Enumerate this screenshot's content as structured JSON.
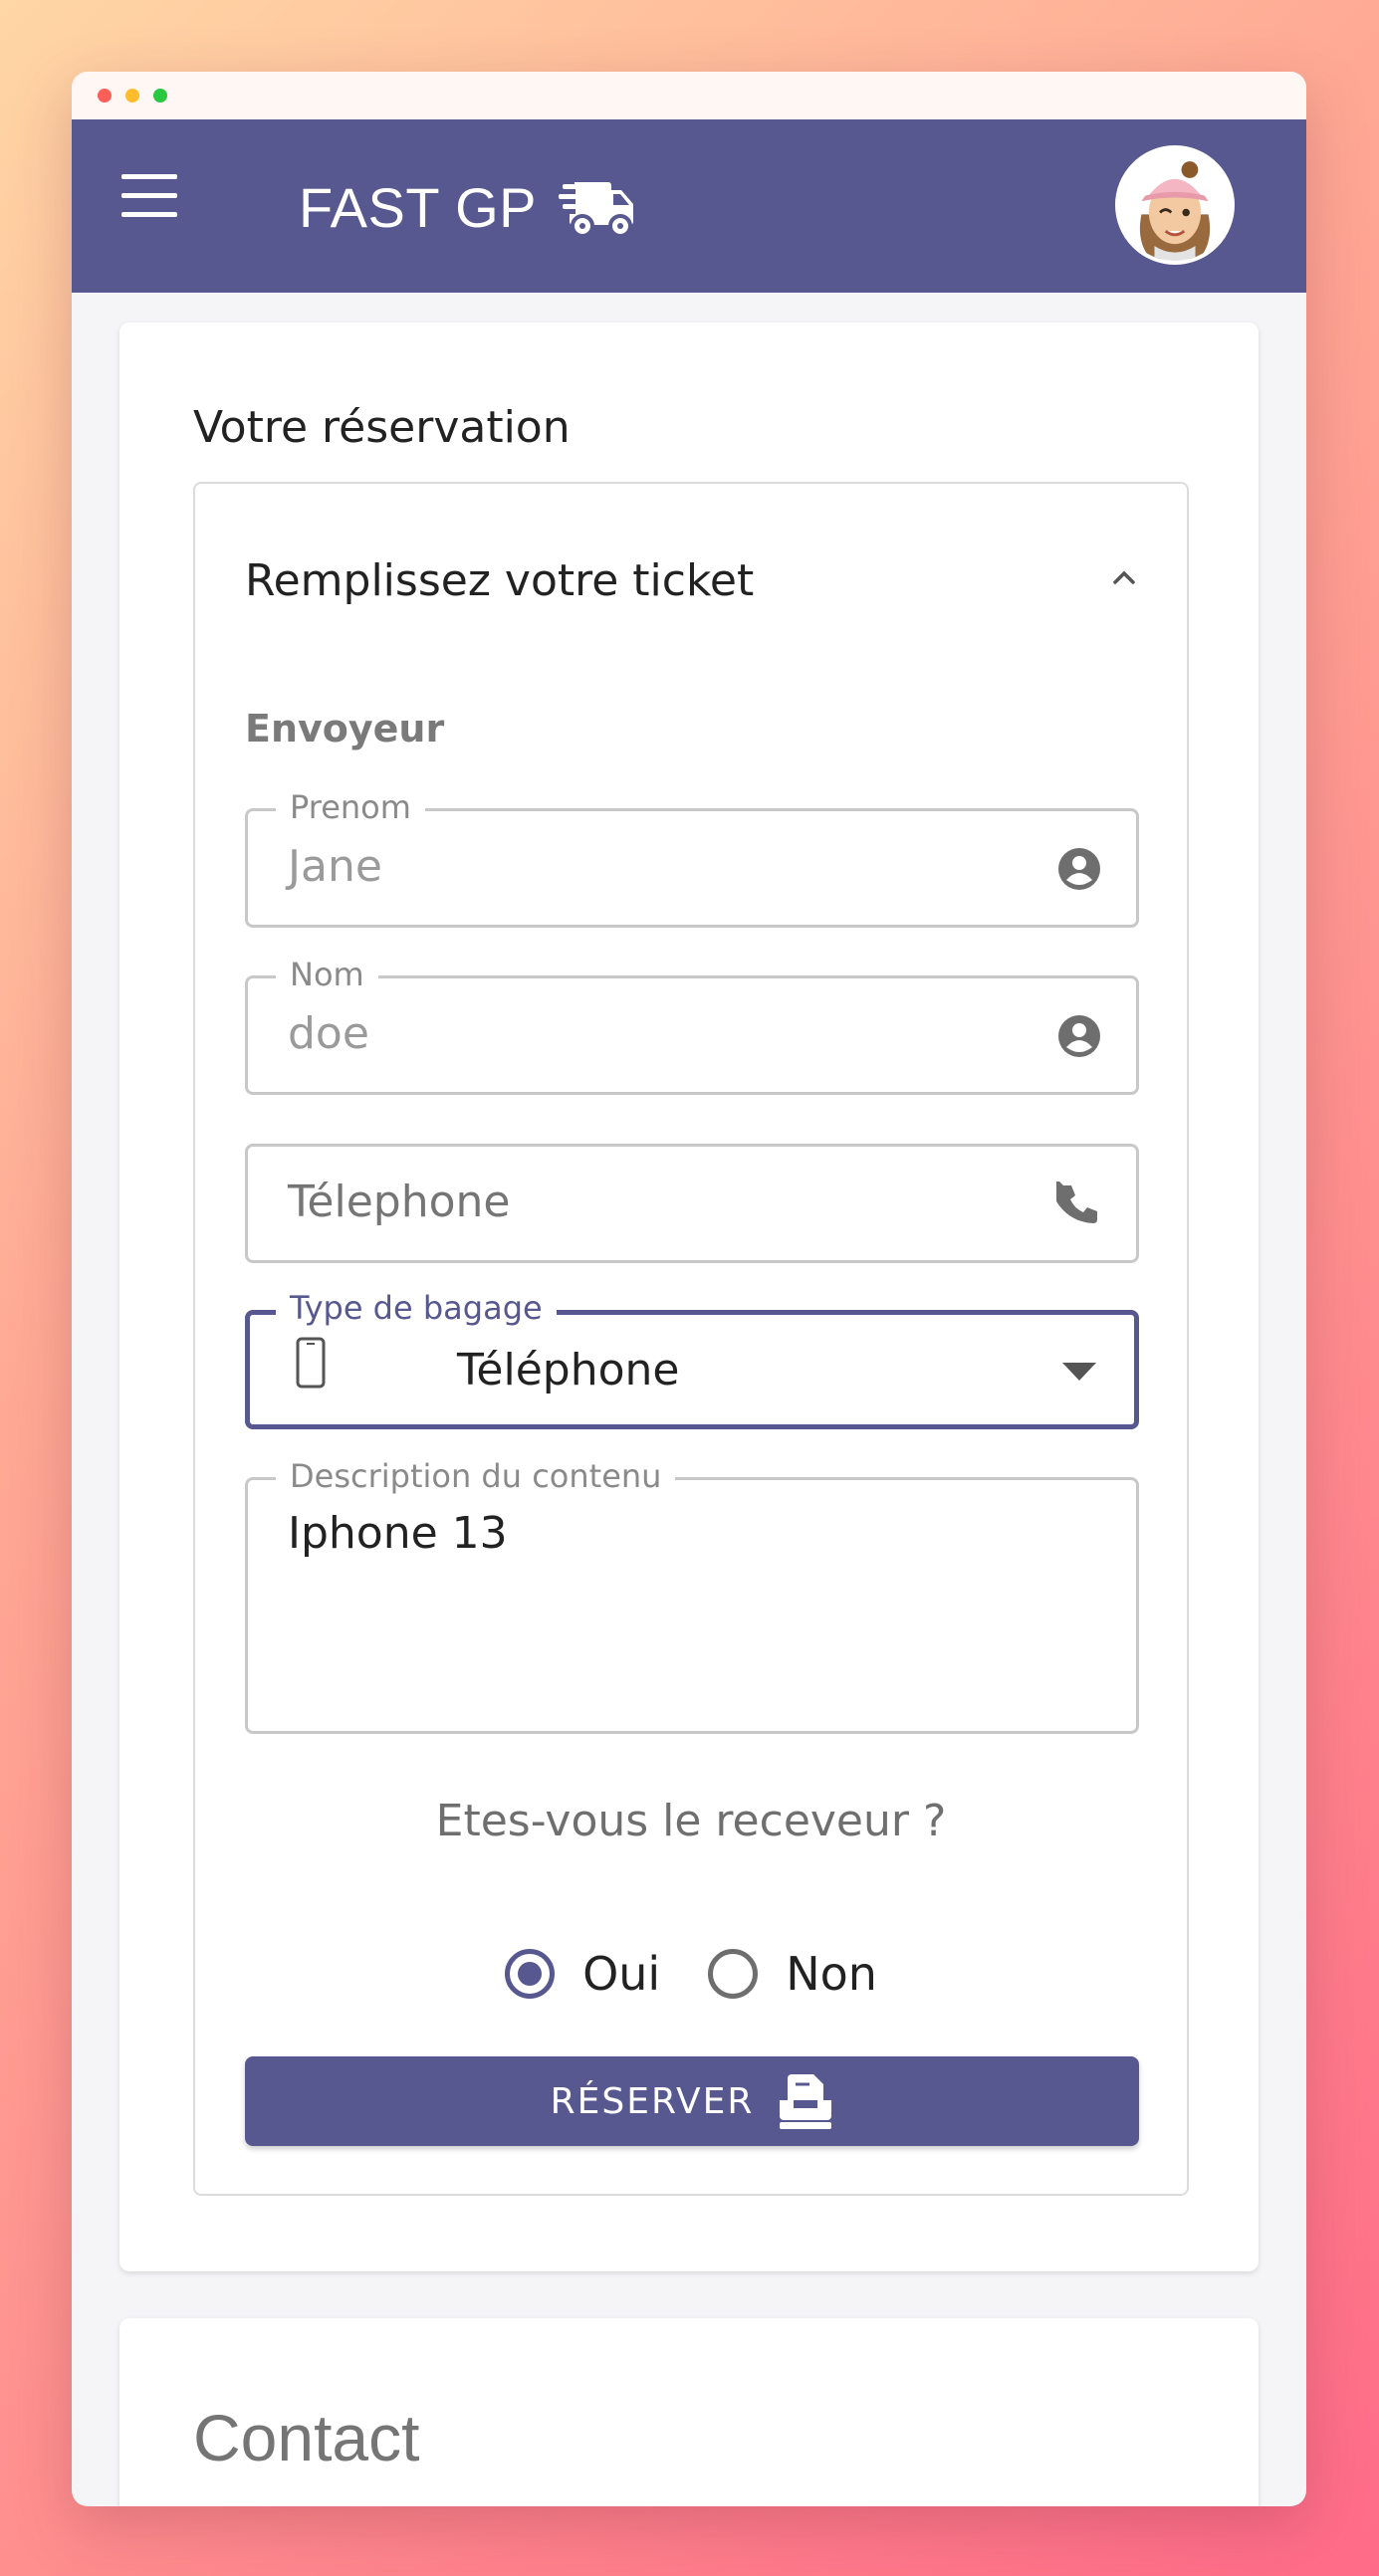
{
  "app": {
    "brand_title": "FAST GP"
  },
  "colors": {
    "primary": "#575890",
    "background_gradient_start": "#ffd6a5",
    "background_gradient_end": "#ff6b88"
  },
  "icons": {
    "menu": "menu-icon",
    "brand": "delivery-truck-icon",
    "avatar": "user-avatar",
    "collapse": "chevron-up-icon",
    "account": "account-circle-icon",
    "phone": "phone-icon",
    "mobile": "smartphone-icon",
    "dropdown": "arrow-drop-down-icon",
    "reserve": "inbox-tray-icon"
  },
  "reservation": {
    "title": "Votre réservation",
    "panel_header": "Remplissez votre ticket",
    "sender_heading": "Envoyeur",
    "fields": {
      "prenom": {
        "label": "Prenom",
        "placeholder": "Jane",
        "value": ""
      },
      "nom": {
        "label": "Nom",
        "placeholder": "doe",
        "value": ""
      },
      "telephone": {
        "label": "",
        "placeholder": "Télephone",
        "value": ""
      },
      "type_bagage": {
        "label": "Type de bagage",
        "selected": "Téléphone"
      },
      "description": {
        "label": "Description du contenu",
        "value": "Iphone 13"
      }
    },
    "receiver_question": "Etes-vous le receveur ?",
    "receiver_options": [
      {
        "label": "Oui",
        "selected": true
      },
      {
        "label": "Non",
        "selected": false
      }
    ],
    "submit_label": "RÉSERVER"
  },
  "contact": {
    "title": "Contact"
  }
}
